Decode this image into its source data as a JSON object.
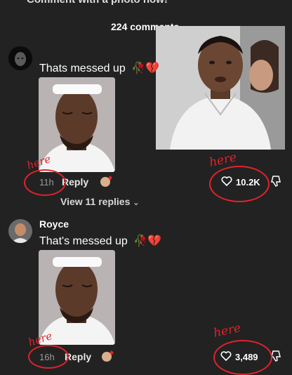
{
  "header": {
    "banner_text": "Comment with a photo now!",
    "comments_count": "224 comments"
  },
  "comments": [
    {
      "username": "",
      "text": "Thats messed up",
      "emojis": [
        "rose-icon",
        "broken-heart-icon"
      ],
      "time": "11h",
      "reply_label": "Reply",
      "view_replies": "View 11 replies",
      "likes": "10.2K"
    },
    {
      "username": "Royce",
      "text": "That's messed up",
      "emojis": [
        "rose-icon",
        "broken-heart-icon"
      ],
      "time": "16h",
      "reply_label": "Reply",
      "likes": "3,489"
    }
  ],
  "annotations": {
    "note": "here"
  },
  "colors": {
    "background": "#222222",
    "annotation_red": "#e0232a"
  }
}
